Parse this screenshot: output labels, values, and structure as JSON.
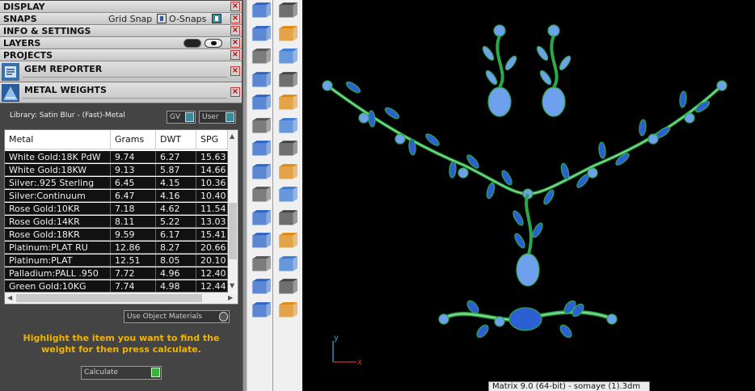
{
  "panel": {
    "display": "DISPLAY",
    "snaps": "SNAPS",
    "grid_snap": "Grid Snap",
    "o_snaps": "O-Snaps",
    "info": "INFO & SETTINGS",
    "layers": "LAYERS",
    "projects": "PROJECTS",
    "gem_reporter": "GEM REPORTER",
    "metal_weights": "METAL WEIGHTS",
    "close": "×"
  },
  "metal": {
    "library": "Library: Satin Blur - (Fast)-Metal",
    "gv_label": "GV",
    "user_label": "User",
    "columns": [
      "Metal",
      "Grams",
      "DWT",
      "SPG"
    ],
    "rows": [
      [
        "White Gold:18K PdW",
        "9.74",
        "6.27",
        "15.63"
      ],
      [
        "White Gold:18KW",
        "9.13",
        "5.87",
        "14.66"
      ],
      [
        "Silver:.925 Sterling",
        "6.45",
        "4.15",
        "10.36"
      ],
      [
        "Silver:Continuum",
        "6.47",
        "4.16",
        "10.40"
      ],
      [
        "Rose Gold:10KR",
        "7.18",
        "4.62",
        "11.54"
      ],
      [
        "Rose Gold:14KR",
        "8.11",
        "5.22",
        "13.03"
      ],
      [
        "Rose Gold:18KR",
        "9.59",
        "6.17",
        "15.41"
      ],
      [
        "Platinum:PLAT RU",
        "12.86",
        "8.27",
        "20.66"
      ],
      [
        "Platinum:PLAT",
        "12.51",
        "8.05",
        "20.10"
      ],
      [
        "Palladium:PALL .950",
        "7.72",
        "4.96",
        "12.40"
      ],
      [
        "Green Gold:10KG",
        "7.74",
        "4.98",
        "12.44"
      ]
    ],
    "use_object_materials": "Use Object Materials",
    "instructions": "Highlight the item you want to find the weight for then press calculate.",
    "calculate": "Calculate"
  },
  "toolbar": {
    "icons": [
      "polygon-tool-icon",
      "curve-tool-icon",
      "edit-points-icon",
      "surface-tool-icon",
      "box-solid-icon",
      "sphere-solid-icon",
      "cylinder-solid-icon",
      "patch-surface-icon",
      "gem-cluster-icon",
      "star-transform-icon",
      "knife-tool-icon",
      "split-tool-icon",
      "gem-set-icon",
      "bubble-tool-icon",
      "arc-tool-icon",
      "fillet-icon",
      "text-tool-icon",
      "scale-icon",
      "array-icon",
      "mirror-icon",
      "solid-edit-icon",
      "pipe-icon",
      "grid-array-icon",
      "rail-icon",
      "boolean-icon",
      "check-icon",
      "cube-icon",
      "material-icon"
    ]
  },
  "viewport": {
    "axis_y": "y",
    "axis_x": "x",
    "colors": {
      "metal": "#2aa84a",
      "gem": "#2d5fd4",
      "gem_light": "#6fa0ee",
      "axis_x": "#d03030",
      "axis_y": "#3aa0d0"
    }
  },
  "status": {
    "text": "Matrix 9.0 (64-bit) - somaye (1).3dm"
  }
}
